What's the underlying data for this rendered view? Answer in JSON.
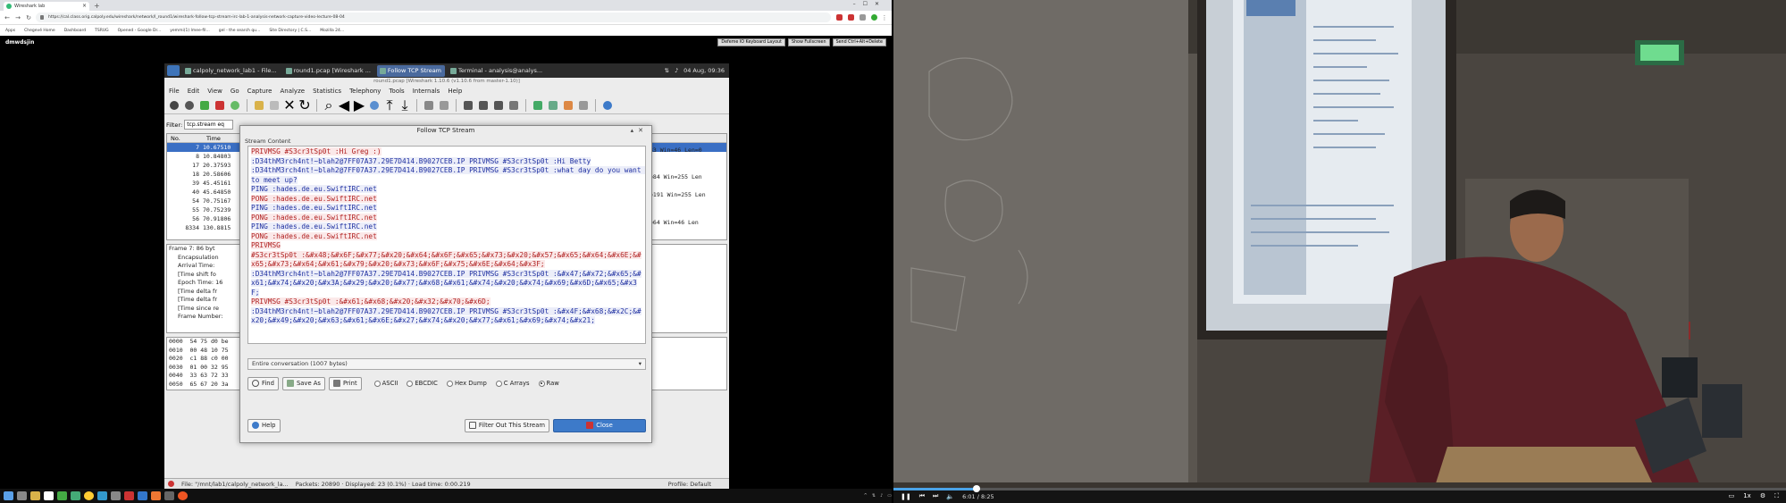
{
  "chrome": {
    "tab_title": "Wireshark lab",
    "url": "https://cal.class.orig.calpoly.edu/wireshark/network/l_round1/wireshark-follow-tcp-stream-irc-lab-1-analysis-network-capture-video-lecture-08-04",
    "bookmarks": [
      "Apps",
      "Chegevé Home",
      "Dashboard",
      "TSRUG",
      "Opened - Google Dr...",
      "yemmi(1) Imee-fil...",
      "gel - the search qu...",
      "Site Directory | C.S...",
      "Mozilla 24..."
    ]
  },
  "vnc": {
    "label": "dmwdsjin",
    "buttons": [
      "Defeme IO Keyboard Layout",
      "Show Fullscreen",
      "Send Ctrl+Alt+Delete"
    ]
  },
  "panel": {
    "tasks": [
      "calpoly_network_lab1 - File...",
      "round1.pcap  [Wireshark ...",
      "Follow TCP Stream",
      "Terminal - analysis@analys..."
    ],
    "active_task": 2,
    "clock": "04 Aug, 09:36"
  },
  "wireshark": {
    "title": "round1.pcap  [Wireshark 1.10.6 (v1.10.6 from master-1.10)]",
    "menu": [
      "File",
      "Edit",
      "View",
      "Go",
      "Capture",
      "Analyze",
      "Statistics",
      "Telephony",
      "Tools",
      "Internals",
      "Help"
    ],
    "filter_label": "Filter:",
    "filter_value": "tcp.stream eq",
    "columns": [
      "No.",
      "Time"
    ],
    "packets": [
      {
        "no": "7",
        "time": "10.67510"
      },
      {
        "no": "8",
        "time": "10.84803"
      },
      {
        "no": "17",
        "time": "20.37593"
      },
      {
        "no": "18",
        "time": "20.58606"
      },
      {
        "no": "39",
        "time": "45.45161"
      },
      {
        "no": "40",
        "time": "45.64850"
      },
      {
        "no": "54",
        "time": "70.75167"
      },
      {
        "no": "55",
        "time": "70.75239"
      },
      {
        "no": "56",
        "time": "70.91806"
      },
      {
        "no": "8334",
        "time": "130.8815"
      }
    ],
    "selected_packet": 0,
    "right_info": [
      "33 Win=46 Len=0",
      "=84 Win=255 Len",
      "=191 Win=255 Len",
      "=64 Win=46 Len"
    ],
    "detail": [
      "Frame 7: 86 byt",
      "Encapsulation",
      "Arrival Time:",
      "[Time shift fo",
      "Epoch Time: 16",
      "[Time delta fr",
      "[Time delta fr",
      "[Time since re",
      "Frame Number:"
    ],
    "hex": [
      {
        "off": "0000",
        "b": "54 75 d0 be"
      },
      {
        "off": "0010",
        "b": "00 48 10 75"
      },
      {
        "off": "0020",
        "b": "c1 88 c0 00"
      },
      {
        "off": "0030",
        "b": "01 00 32 95"
      },
      {
        "off": "0040",
        "b": "33 63 72 33"
      },
      {
        "off": "0050",
        "b": "65 67 20 3a"
      }
    ],
    "status_file": "File: \"/mnt/lab1/calpoly_network_la...",
    "status_packets": "Packets: 20890 · Displayed: 23 (0.1%) · Load time: 0:00.219",
    "status_profile": "Profile: Default"
  },
  "dialog": {
    "title": "Follow TCP Stream",
    "group_label": "Stream Content",
    "lines": [
      {
        "c": "red",
        "t": "PRIVMSG #S3cr3tSp0t :Hi Greg :)"
      },
      {
        "c": "blue",
        "t": ":D34thM3rch4nt!~blah2@7FF07A37.29E7D414.B9027CEB.IP PRIVMSG #S3cr3tSp0t :Hi Betty"
      },
      {
        "c": "blue",
        "t": ":D34thM3rch4nt!~blah2@7FF07A37.29E7D414.B9027CEB.IP PRIVMSG #S3cr3tSp0t :what day do you want to meet up?"
      },
      {
        "c": "blue",
        "t": "PING :hades.de.eu.SwiftIRC.net"
      },
      {
        "c": "red",
        "t": "PONG :hades.de.eu.SwiftIRC.net"
      },
      {
        "c": "blue",
        "t": "PING :hades.de.eu.SwiftIRC.net"
      },
      {
        "c": "red",
        "t": "PONG :hades.de.eu.SwiftIRC.net"
      },
      {
        "c": "blue",
        "t": "PING :hades.de.eu.SwiftIRC.net"
      },
      {
        "c": "red",
        "t": "PONG :hades.de.eu.SwiftIRC.net"
      },
      {
        "c": "red",
        "t": "PRIVMSG"
      },
      {
        "c": "red",
        "t": "#S3cr3tSp0t :&#x48;&#x6F;&#x77;&#x20;&#x64;&#x6F;&#x65;&#x73;&#x20;&#x57;&#x65;&#x64;&#x6E;&#x65;&#x73;&#x64;&#x61;&#x79;&#x20;&#x73;&#x6F;&#x75;&#x6E;&#x64;&#x3F;"
      },
      {
        "c": "blue",
        "t": ":D34thM3rch4nt!~blah2@7FF07A37.29E7D414.B9027CEB.IP PRIVMSG #S3cr3tSp0t :&#x47;&#x72;&#x65;&#x61;&#x74;&#x20;&#x3A;&#x29;&#x20;&#x77;&#x68;&#x61;&#x74;&#x20;&#x74;&#x69;&#x6D;&#x65;&#x3F;"
      },
      {
        "c": "red",
        "t": "PRIVMSG #S3cr3tSp0t :&#x61;&#x68;&#x20;&#x32;&#x70;&#x6D;"
      },
      {
        "c": "blue",
        "t": ":D34thM3rch4nt!~blah2@7FF07A37.29E7D414.B9027CEB.IP PRIVMSG #S3cr3tSp0t :&#x4F;&#x68;&#x2C;&#x20;&#x49;&#x20;&#x63;&#x61;&#x6E;&#x27;&#x74;&#x20;&#x77;&#x61;&#x69;&#x74;&#x21;"
      }
    ],
    "conversation": "Entire conversation (1007 bytes)",
    "find_label": "Find",
    "saveas_label": "Save As",
    "print_label": "Print",
    "encodings": [
      "ASCII",
      "EBCDIC",
      "Hex Dump",
      "C Arrays",
      "Raw"
    ],
    "selected_encoding": 4,
    "help_label": "Help",
    "filter_out_label": "Filter Out This Stream",
    "close_label": "Close"
  },
  "video": {
    "elapsed": "6:01 / 8:25",
    "progress": 0.093
  }
}
